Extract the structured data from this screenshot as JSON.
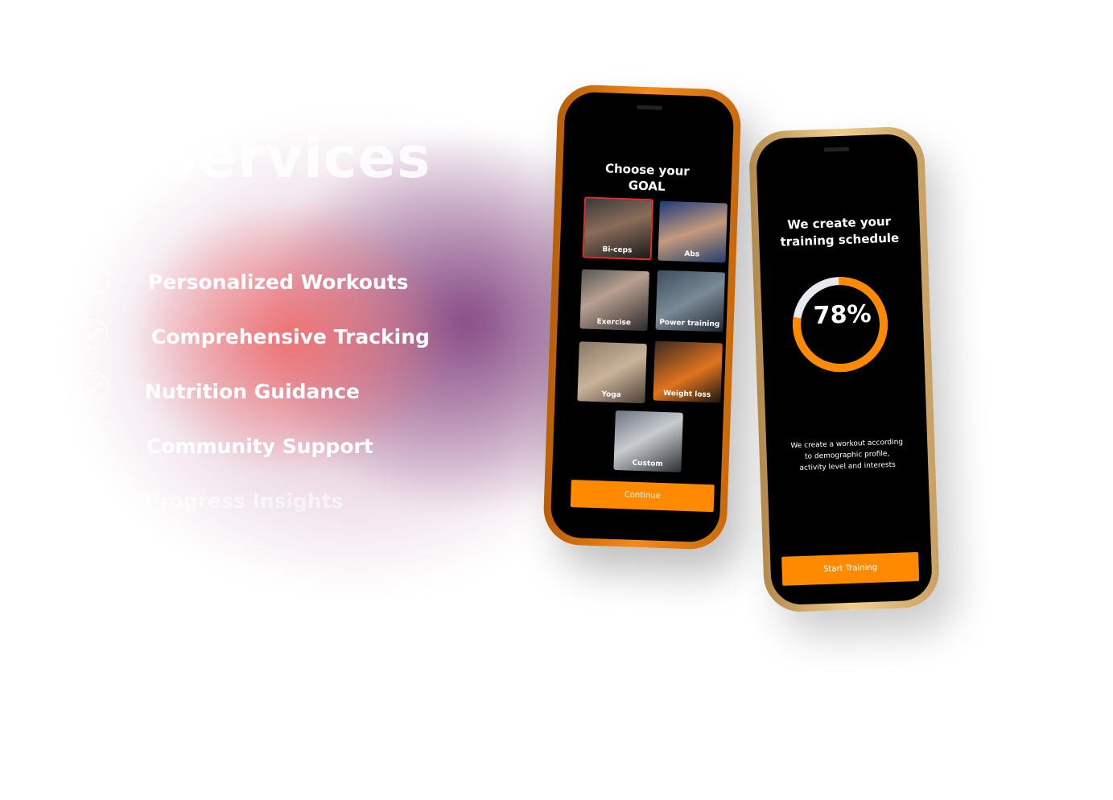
{
  "section": {
    "title": "Services",
    "items": [
      "Personalized Workouts",
      "Comprehensive Tracking",
      "Nutrition Guidance",
      "Community Support",
      "Progress Insights"
    ]
  },
  "phone1": {
    "title_line1": "Choose your",
    "title_line2": "GOAL",
    "goals": [
      "Bi-ceps",
      "Abs",
      "Exercise",
      "Power training",
      "Yoga",
      "Weight loss",
      "Custom"
    ],
    "selected_goal": "Bi-ceps",
    "button": "Continue"
  },
  "phone2": {
    "title_line1": "We create your",
    "title_line2": "training schedule",
    "progress_label": "78%",
    "progress_value": 0.78,
    "description": "We create a workout according to demographic profile, activity level and interests",
    "button": "Start Training"
  },
  "colors": {
    "accent": "#ff8a00",
    "selected_border": "#e03030",
    "screen_bg": "#000000"
  }
}
